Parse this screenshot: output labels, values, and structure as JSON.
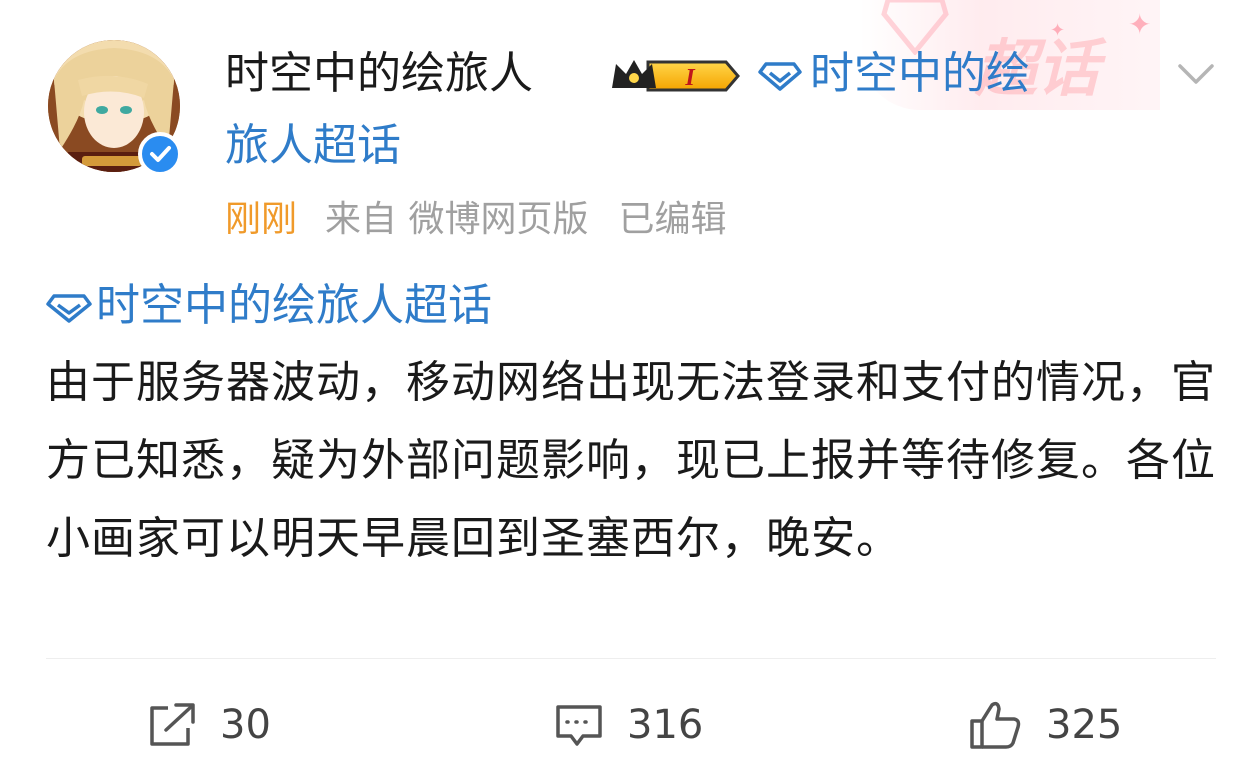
{
  "post": {
    "author": {
      "name": "时空中的绘旅人",
      "verified": true,
      "level_badge": "I"
    },
    "header_topic": {
      "line1": "时空中的绘",
      "line2": "旅人超话"
    },
    "super_topic_watermark": "超话",
    "meta": {
      "time": "刚刚",
      "source": "来自 微博网页版",
      "edited": "已编辑"
    },
    "body_topic": "时空中的绘旅人超话",
    "content": "由于服务器波动，移动网络出现无法登录和支付的情况，官方已知悉，疑为外部问题影响，现已上报并等待修复。各位小画家可以明天早晨回到圣塞西尔，晚安。",
    "actions": {
      "repost_count": "30",
      "comment_count": "316",
      "like_count": "325"
    }
  },
  "colors": {
    "link": "#2f7cc9",
    "time": "#f09a2a",
    "meta": "#a0a0a0",
    "verified": "#2a8cf0"
  },
  "icons": {
    "gem": "diamond-gem-icon",
    "repost": "share-box-arrow-icon",
    "comment": "comment-bubble-icon",
    "like": "thumbs-up-icon",
    "more": "chevron-down-icon",
    "verified": "verified-check-icon",
    "crown": "crown-icon"
  }
}
